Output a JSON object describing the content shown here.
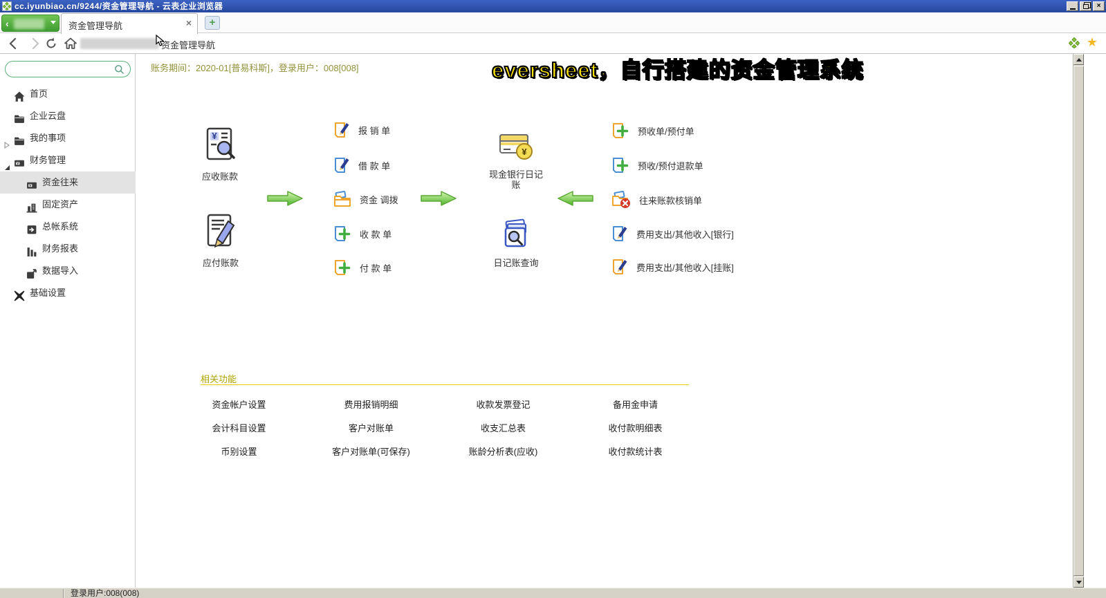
{
  "window": {
    "title": "cc.iyunbiao.cn/9244/资金管理导航 - 云表企业浏览器"
  },
  "tab_bar": {
    "active_tab_title": "资金管理导航",
    "close_glyph": "×",
    "new_tab_glyph": "+"
  },
  "nav_bar": {
    "page_title": "资金管理导航"
  },
  "sidebar": {
    "search": {
      "placeholder": "",
      "icon": "search-icon"
    },
    "items": [
      {
        "label": "首页",
        "icon": "home-icon"
      },
      {
        "label": "企业云盘",
        "icon": "folder-icon"
      },
      {
        "label": "我的事项",
        "icon": "folder-icon",
        "state": "collapsed"
      },
      {
        "label": "财务管理",
        "icon": "finance-card-icon",
        "state": "expanded"
      },
      {
        "label": "资金往来",
        "icon": "finance-card-icon",
        "selected": true
      },
      {
        "label": "固定资产",
        "icon": "building-icon"
      },
      {
        "label": "总帐系统",
        "icon": "ledger-icon"
      },
      {
        "label": "财务报表",
        "icon": "bar-chart-icon"
      },
      {
        "label": "数据导入",
        "icon": "export-icon"
      },
      {
        "label": "基础设置",
        "icon": "settings-icon"
      }
    ]
  },
  "main": {
    "period_bar": "账务期间：2020-01[普易科斯]，登录用户：008[008]",
    "overlay_caption": "eversheet，自行搭建的资金管理系统",
    "flow": {
      "left_nodes": [
        {
          "label": "应收账款",
          "icon": "receivable-doc-icon"
        },
        {
          "label": "应付账款",
          "icon": "payable-doc-icon"
        }
      ],
      "mid_items": [
        {
          "label": "报 销 单",
          "icon": "doc-pen-orange-icon"
        },
        {
          "label": "借 款 单",
          "icon": "doc-pen-blue-icon"
        },
        {
          "label": "资金 调拨",
          "icon": "folder-transfer-icon"
        },
        {
          "label": "收 款 单",
          "icon": "doc-plus-blue-icon"
        },
        {
          "label": "付 款 单",
          "icon": "doc-plus-orange-icon"
        }
      ],
      "center_nodes": [
        {
          "label": "现金银行日记账",
          "icon": "bank-card-icon"
        },
        {
          "label": "日记账查询",
          "icon": "journal-search-icon"
        }
      ],
      "right_items": [
        {
          "label": "预收单/预付单",
          "icon": "doc-plus-orange-icon"
        },
        {
          "label": "预收/预付退款单",
          "icon": "doc-plus-blue-icon"
        },
        {
          "label": "往来账款核销单",
          "icon": "folder-cancel-icon"
        },
        {
          "label": "费用支出/其他收入[银行]",
          "icon": "doc-pen-blue-icon"
        },
        {
          "label": "费用支出/其他收入[挂账]",
          "icon": "doc-pen-orange-icon"
        }
      ]
    },
    "related": {
      "title": "相关功能",
      "links": [
        "资金帐户设置",
        "费用报销明细",
        "收款发票登记",
        "备用金申请",
        "会计科目设置",
        "客户对账单",
        "收支汇总表",
        "收付款明细表",
        "币别设置",
        "客户对账单(可保存)",
        "账龄分析表(应收)",
        "收付款统计表"
      ]
    }
  },
  "status_bar": {
    "text": "登录用户:008(008)"
  },
  "colors": {
    "titlebar_blue": "#2b52b0",
    "accent_green": "#4caf50",
    "caption_yellow": "#ffe400",
    "olive_text": "#92923a",
    "related_title_yellow": "#aea400",
    "related_underline_yellow": "#e6cf00",
    "star_yellow": "#f5b824",
    "arrow_green": "#4fb32a"
  }
}
